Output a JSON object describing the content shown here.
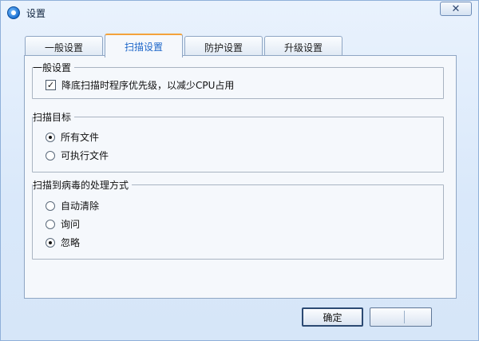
{
  "window": {
    "title": "设置",
    "close_symbol": "✕"
  },
  "tabs": [
    {
      "label": "一般设置",
      "active": false
    },
    {
      "label": "扫描设置",
      "active": true
    },
    {
      "label": "防护设置",
      "active": false
    },
    {
      "label": "升级设置",
      "active": false
    }
  ],
  "groups": {
    "general": {
      "label": "一般设置",
      "checkbox": {
        "label": "降底扫描时程序优先级，以减少CPU占用",
        "checked": true
      }
    },
    "scan_target": {
      "label": "扫描目标",
      "options": [
        {
          "label": "所有文件",
          "selected": true
        },
        {
          "label": "可执行文件",
          "selected": false
        }
      ]
    },
    "virus_action": {
      "label": "扫描到病毒的处理方式",
      "options": [
        {
          "label": "自动清除",
          "selected": false
        },
        {
          "label": "询问",
          "selected": false
        },
        {
          "label": "忽略",
          "selected": true
        }
      ]
    }
  },
  "buttons": {
    "ok": "确定",
    "cancel": ""
  },
  "checkmark": "✓"
}
